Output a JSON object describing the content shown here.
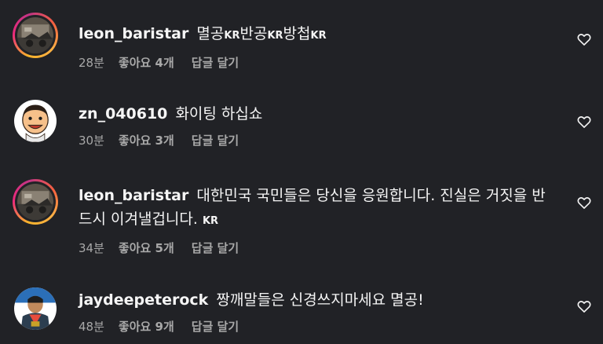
{
  "comments": [
    {
      "username": "leon_baristar",
      "text_parts": [
        "멸공",
        "KR",
        "반공",
        "KR",
        "방첩",
        "KR"
      ],
      "time": "28분",
      "likes": "좋아요 4개",
      "reply": "답글 달기"
    },
    {
      "username": "zn_040610",
      "text": "화이팅 하십쇼",
      "time": "30분",
      "likes": "좋아요 3개",
      "reply": "답글 달기"
    },
    {
      "username": "leon_baristar",
      "text": "대한민국 국민들은 당신을 응원합니다. 진실은 거짓을 반드시 이겨낼겁니다.",
      "text_suffix": "KR",
      "time": "34분",
      "likes": "좋아요 5개",
      "reply": "답글 달기"
    },
    {
      "username": "jaydeepeterock",
      "text": "짱깨말들은 신경쓰지마세요 멸공!",
      "time": "48분",
      "likes": "좋아요 9개",
      "reply": "답글 달기"
    }
  ],
  "icons": {
    "like": "heart-outline-icon"
  },
  "colors": {
    "background": "#212226",
    "text": "#f5f5f5",
    "meta": "#a8a8a8"
  }
}
